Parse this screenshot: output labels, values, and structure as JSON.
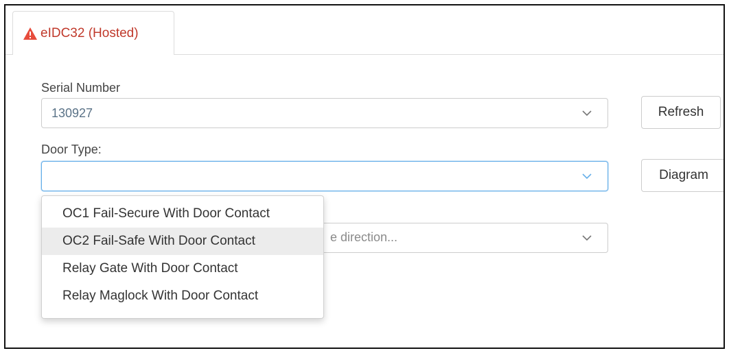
{
  "tab": {
    "label": "eIDC32 (Hosted)",
    "icon": "warning-icon",
    "icon_color": "#e74c3c",
    "label_color": "#c0392b"
  },
  "serial": {
    "label": "Serial Number",
    "value": "130927",
    "button": "Refresh"
  },
  "door_type": {
    "label": "Door Type:",
    "value": "",
    "button": "Diagram"
  },
  "direction": {
    "placeholder_fragment": "e direction..."
  },
  "dropdown": {
    "items": [
      "OC1 Fail-Secure With Door Contact",
      "OC2 Fail-Safe With Door Contact",
      "Relay Gate With Door Contact",
      "Relay Maglock With Door Contact"
    ],
    "hovered_index": 1
  },
  "colors": {
    "focus_border": "#66afe9",
    "hover_bg": "#ececec"
  }
}
